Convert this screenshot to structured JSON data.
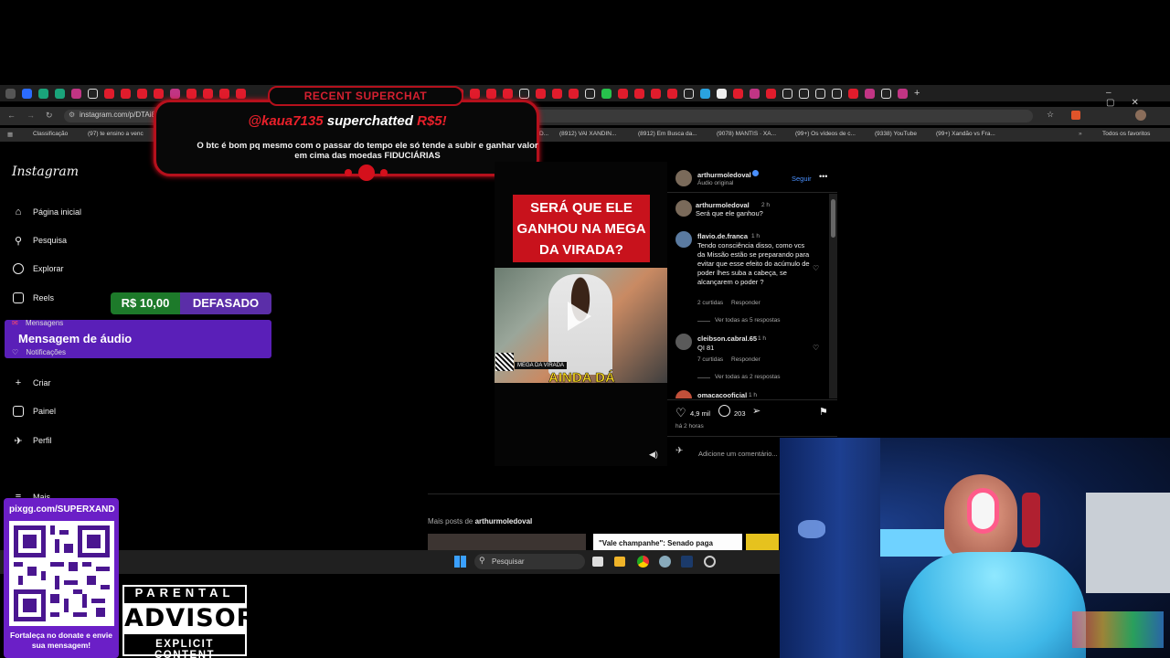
{
  "browser": {
    "url": "instagram.com/p/DTAi8",
    "bookmarks": [
      "Classificação",
      "(97) te ensino a venc",
      "D...",
      "(8912) VAI XANDIN...",
      "(8912) Em Busca da...",
      "(9078) MANTIS · XA...",
      "(99+) Os vídeos de c...",
      "(9338) YouTube",
      "(99+) Xandão vs Fra...",
      "Todos os favoritos"
    ]
  },
  "instagram": {
    "logo": "Instagram",
    "nav": {
      "home": "Página inicial",
      "search": "Pesquisa",
      "explore": "Explorar",
      "reels": "Reels",
      "messages": "Mensagens",
      "notifications": "Notificações",
      "create": "Criar",
      "dashboard": "Painel",
      "profile": "Perfil",
      "more": "Mais"
    },
    "post": {
      "author": "arthurmoledoval",
      "audio": "Áudio original",
      "follow": "Seguir",
      "banner_text": "SERÁ QUE ELE GANHOU NA MEGA DA VIRADA?",
      "video_caption": "AINDA DÁ",
      "video_badge": "MEGA DA VIRADA",
      "likes": "4,9 mil",
      "comments_count": "203",
      "posted": "há 2 horas",
      "add_comment_placeholder": "Adicione um comentário..."
    },
    "comments": [
      {
        "user": "arthurmoledoval",
        "time": "2 h",
        "text": "Será que ele ganhou?"
      },
      {
        "user": "flavio.de.franca",
        "time": "1 h",
        "text": "Tendo consciência disso, como vcs da Missão estão se preparando para evitar que esse efeito do acúmulo de poder lhes suba a cabeça, se alcançarem o poder ?",
        "meta_likes": "2 curtidas",
        "reply": "Responder",
        "view_replies": "Ver todas as 5 respostas"
      },
      {
        "user": "cleibson.cabral.65",
        "time": "1 h",
        "text": "QI 81",
        "meta_likes": "7 curtidas",
        "reply": "Responder",
        "view_replies": "Ver todas as 2 respostas"
      },
      {
        "user": "omacacooficial",
        "time": "1 h",
        "text": ""
      }
    ],
    "more_posts_prefix": "Mais posts de",
    "more_posts_user": "arthurmoledoval",
    "thumb_headline": "\"Vale champanhe\": Senado paga"
  },
  "overlay": {
    "superchat_header": "RECENT SUPERCHAT",
    "superchat_user": "@kaua7135",
    "superchat_verb": "superchatted",
    "superchat_amount": "R$5!",
    "superchat_message": "O btc é bom pq mesmo com o passar do tempo ele só tende a subir e ganhar valor em cima das moedas FIDUCIÁRIAS",
    "price": "R$ 10,00",
    "price_tag": "DEFASADO",
    "audio_title": "Mensagem de áudio",
    "qr_url": "pixgg.com/SUPERXAND",
    "qr_caption": "Fortaleça no donate e envie sua mensagem!",
    "pa_top": "PARENTAL",
    "pa_mid": "ADVISORY",
    "pa_bot": "EXPLICIT CONTENT"
  },
  "taskbar": {
    "search_placeholder": "Pesquisar"
  },
  "colors": {
    "accent_purple": "#5a1fb8",
    "superchat_red": "#d42030",
    "follow_blue": "#4a90ff",
    "reel_banner_red": "#c8121c",
    "caption_yellow": "#ffde20"
  }
}
